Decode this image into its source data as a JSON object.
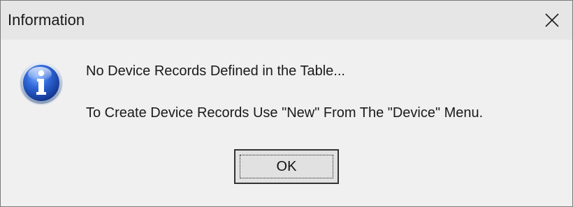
{
  "window": {
    "title": "Information",
    "close_icon": "close-icon"
  },
  "message": {
    "icon": "information-icon",
    "line1": "No Device Records Defined in the Table...",
    "line2": "To Create Device Records Use \"New\" From The \"Device\" Menu."
  },
  "buttons": {
    "ok_label": "OK"
  },
  "colors": {
    "titlebar_bg": "#e6e6e6",
    "body_bg": "#f0f0f0",
    "icon_blue": "#1f4fb5"
  }
}
